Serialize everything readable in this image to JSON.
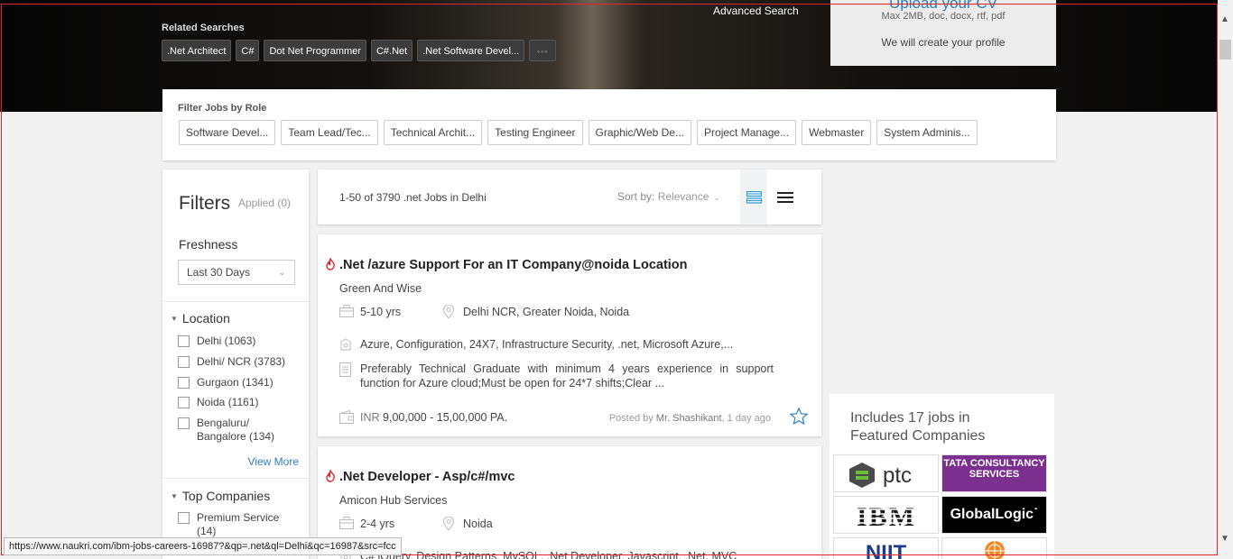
{
  "hero": {
    "related_title": "Related Searches",
    "related": [
      ".Net Architect",
      "C#",
      "Dot Net Programmer",
      "C#.Net",
      ".Net Software Devel...",
      "◦◦◦"
    ],
    "advanced_search": "Advanced Search",
    "upload": {
      "title": "Upload your CV",
      "formats": "Max 2MB, doc, docx, rtf, pdf",
      "note": "We will create your profile"
    }
  },
  "roles": {
    "title": "Filter Jobs by Role",
    "items": [
      "Software Devel...",
      "Team Lead/Tec...",
      "Technical Archit...",
      "Testing Engineer",
      "Graphic/Web De...",
      "Project Manage...",
      "Webmaster",
      "System Adminis..."
    ]
  },
  "filters": {
    "title": "Filters",
    "applied": "Applied (0)",
    "freshness_label": "Freshness",
    "freshness_value": "Last 30 Days",
    "location": {
      "title": "Location",
      "options": [
        "Delhi (1063)",
        "Delhi/ NCR (3783)",
        "Gurgaon (1341)",
        "Noida (1161)",
        "Bengaluru/ Bangalore (134)"
      ],
      "view_more": "View More"
    },
    "top_companies": {
      "title": "Top Companies",
      "options": [
        "Premium Service (14)"
      ]
    }
  },
  "results": {
    "count_text": "1-50 of 3790 .net Jobs in Delhi",
    "sort_label": "Sort by:",
    "sort_value": "Relevance"
  },
  "jobs": [
    {
      "title": ".Net /azure Support For an IT Company@noida Location",
      "company": "Green And Wise",
      "experience": "5-10 yrs",
      "location": "Delhi NCR, Greater Noida, Noida",
      "skills": "Azure, Configuration, 24X7, Infrastructure Security, .net, Microsoft Azure,...",
      "description": "Preferably Technical Graduate with minimum 4 years experience in support function for Azure cloud;Must be open for 24*7 shifts;Clear ...",
      "currency": "INR",
      "salary": "9,00,000 - 15,00,000 PA.",
      "posted_prefix": "Posted by",
      "posted_by": "Mr. Shashikant",
      "posted_when": ", 1 day ago"
    },
    {
      "title": ".Net Developer - Asp/c#/mvc",
      "company": "Amicon Hub Services",
      "experience": "2-4 yrs",
      "location": "Noida",
      "skills": "C# jQuery, Design Patterns, MySQL, .Net Developer, Javascript, .Net, MVC"
    }
  ],
  "featured": {
    "title": "Includes 17 jobs in Featured Companies",
    "logos": {
      "ptc": "ptc",
      "tcs": "TATA CONSULTANCY SERVICES",
      "ibm": "IBM",
      "globallogic": "GlobalLogic˙",
      "niit": "NIIT"
    }
  },
  "status_url": "https://www.naukri.com/ibm-jobs-careers-16987?&qp=.net&ql=Delhi&qc=16987&src=fcc",
  "colors": {
    "link": "#2e7fc1",
    "frame": "#e0252a",
    "tcs": "#7b2f8e"
  }
}
